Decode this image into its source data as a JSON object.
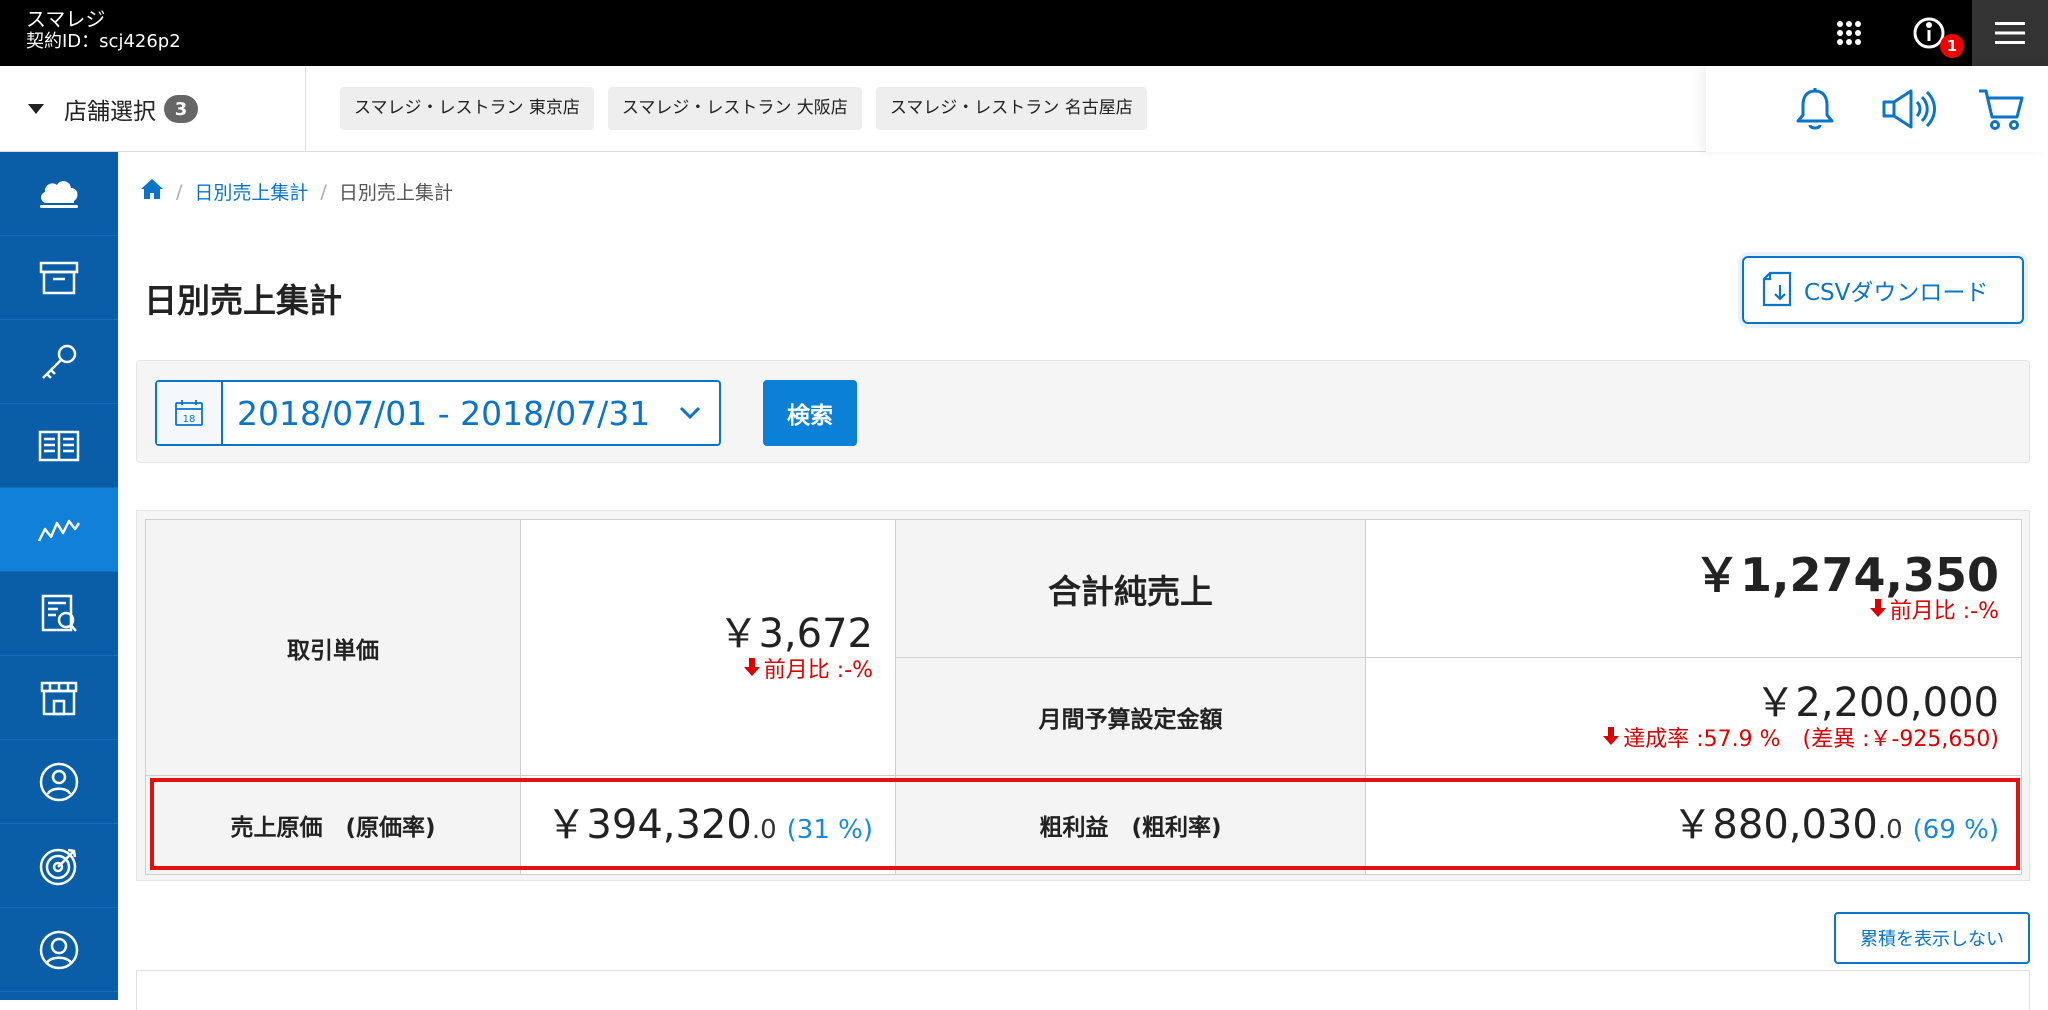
{
  "app": {
    "name": "スマレジ",
    "contract_id": "契約ID：scj426p2"
  },
  "topbar": {
    "apps_icon": "grid-apps-icon",
    "info_icon": "info-icon",
    "info_badge": "1",
    "menu_icon": "hamburger-menu-icon"
  },
  "stores": {
    "select_label": "店舗選択",
    "selected_count": "3",
    "chips": [
      "スマレジ・レストラン 東京店",
      "スマレジ・レストラン 大阪店",
      "スマレジ・レストラン 名古屋店"
    ]
  },
  "actions": {
    "bell_icon": "bell-icon",
    "megaphone_icon": "megaphone-icon",
    "cart_icon": "cart-icon"
  },
  "sidebar": {
    "items": [
      {
        "icon": "cloud-icon",
        "active": false
      },
      {
        "icon": "archive-box-icon",
        "active": false
      },
      {
        "icon": "key-icon",
        "active": false
      },
      {
        "icon": "book-icon",
        "active": false
      },
      {
        "icon": "line-chart-icon",
        "active": true
      },
      {
        "icon": "report-icon",
        "active": false
      },
      {
        "icon": "store-icon",
        "active": false
      },
      {
        "icon": "user-circle-icon",
        "active": false
      },
      {
        "icon": "target-icon",
        "active": false
      },
      {
        "icon": "account-icon",
        "active": false
      }
    ]
  },
  "breadcrumb": {
    "home_icon": "home-icon",
    "sep": "/",
    "parent": "日別売上集計",
    "current": "日別売上集計"
  },
  "page": {
    "title": "日別売上集計",
    "csv_button": "CSVダウンロード"
  },
  "search": {
    "date_range": "2018/07/01 - 2018/07/31",
    "calendar_day": "18",
    "search_button": "検索"
  },
  "summary": {
    "unit_price_label": "取引単価",
    "unit_price_value": "￥3,672",
    "unit_price_note": "前月比 :-%",
    "net_sales_label": "合計純売上",
    "net_sales_value": "￥1,274,350",
    "net_sales_note": "前月比 :-%",
    "budget_label": "月間予算設定金額",
    "budget_value": "￥2,200,000",
    "budget_note": "達成率 :57.9 %　(差異 :￥-925,650)",
    "cost_label": "売上原価　(原価率)",
    "cost_value": "￥394,320",
    "cost_decimal": ".0",
    "cost_rate": "(31 %)",
    "gross_label": "粗利益　(粗利率)",
    "gross_value": "￥880,030",
    "gross_decimal": ".0",
    "gross_rate": "(69 %)"
  },
  "cumulative_button": "累積を表示しない",
  "colors": {
    "brand_blue": "#0a5ea8",
    "accent_blue": "#0a74c8",
    "negative_red": "#dd0000",
    "highlight_red": "#e41010"
  }
}
